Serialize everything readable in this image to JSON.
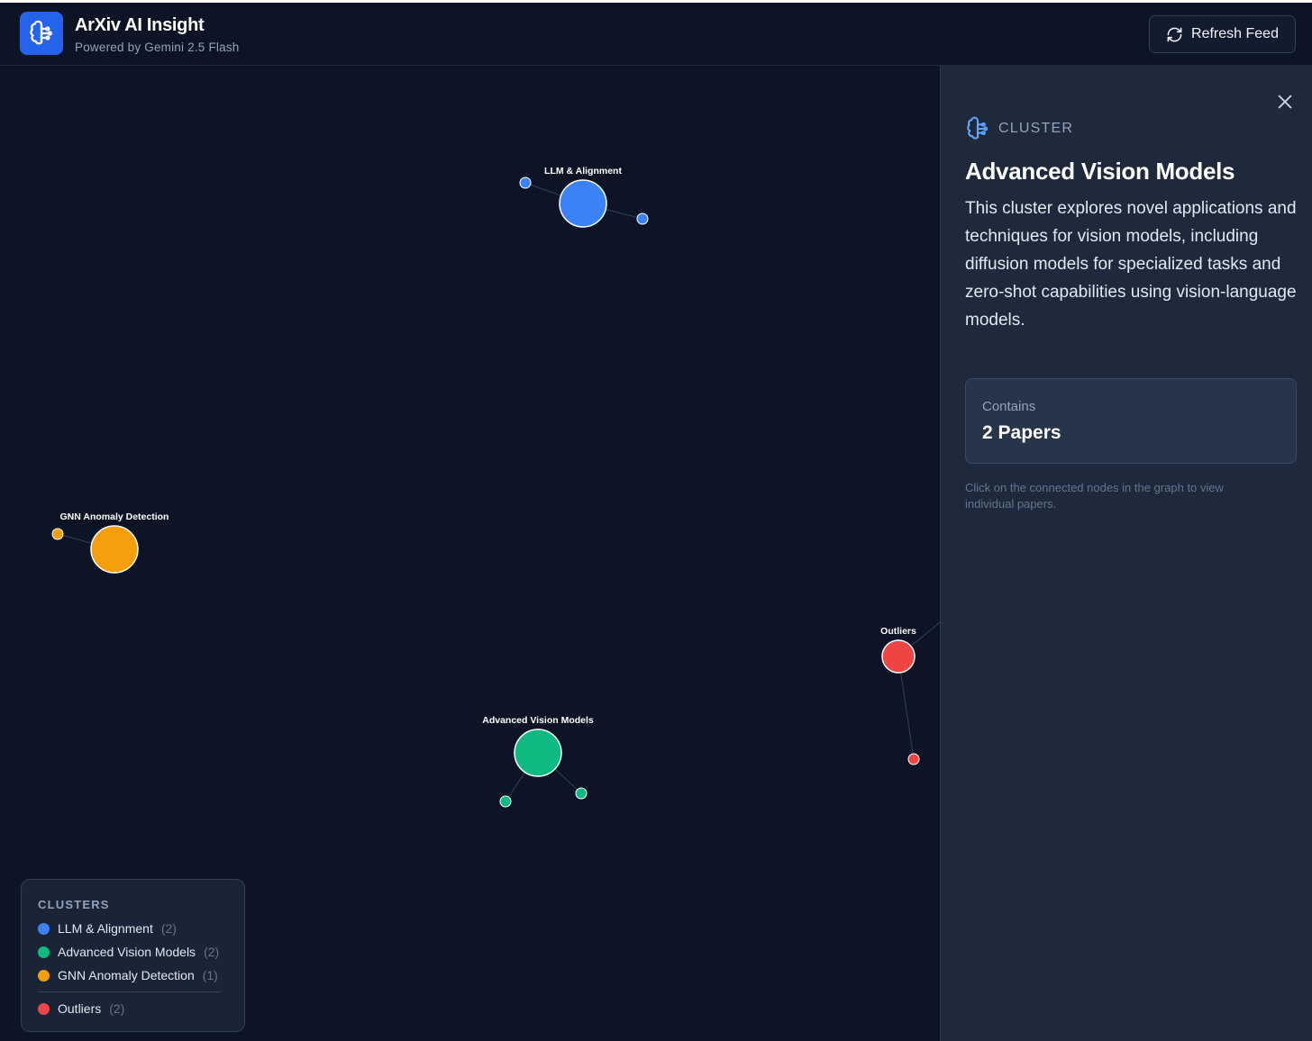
{
  "header": {
    "title": "ArXiv AI Insight",
    "subtitle": "Powered by Gemini 2.5 Flash",
    "refresh_label": "Refresh Feed"
  },
  "panel": {
    "kind": "CLUSTER",
    "title": "Advanced Vision Models",
    "description": "This cluster explores novel applications and techniques for vision models, including diffusion models for specialized tasks and zero-shot capabilities using vision-language models.",
    "contains_label": "Contains",
    "contains_count": "2 Papers",
    "hint": "Click on the connected nodes in the graph to view individual papers."
  },
  "legend": {
    "title": "CLUSTERS",
    "items": [
      {
        "label": "LLM & Alignment",
        "count": "(2)",
        "color": "#3b82f6"
      },
      {
        "label": "Advanced Vision Models",
        "count": "(2)",
        "color": "#10b981"
      },
      {
        "label": "GNN Anomaly Detection",
        "count": "(1)",
        "color": "#f59e0b"
      },
      {
        "label": "Outliers",
        "count": "(2)",
        "color": "#ef4444"
      }
    ]
  },
  "graph": {
    "clusters": [
      {
        "label": "LLM & Alignment",
        "color": "#3b82f6"
      },
      {
        "label": "GNN Anomaly Detection",
        "color": "#f59e0b"
      },
      {
        "label": "Outliers",
        "color": "#ef4444"
      },
      {
        "label": "Advanced Vision Models",
        "color": "#10b981"
      }
    ]
  },
  "colors": {
    "accent": "#2563eb",
    "background": "#0c1425",
    "panel": "#1e293b"
  }
}
